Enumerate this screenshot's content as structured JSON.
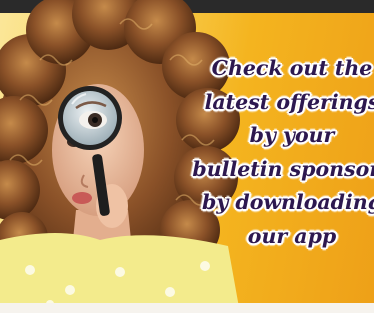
{
  "ad": {
    "headline_lines": [
      "Check out the",
      "latest offerings",
      "by your",
      "bulletin sponsors",
      "by downloading",
      "our app"
    ]
  }
}
